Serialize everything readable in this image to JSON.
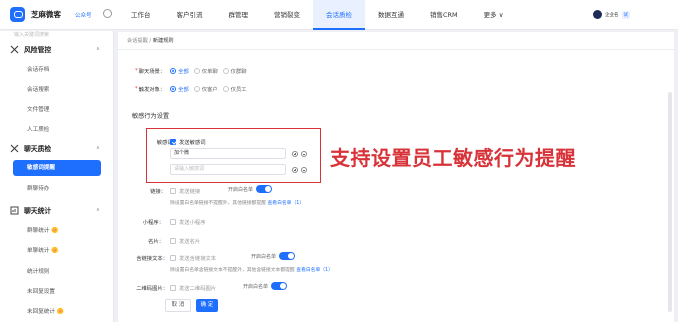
{
  "app": {
    "name": "芝麻微客",
    "badge": "公众号"
  },
  "topnav": {
    "items": [
      "工作台",
      "客户引流",
      "群管理",
      "营销裂变",
      "会话质检",
      "数据互通",
      "销售CRM",
      "更多 ∨"
    ],
    "active_index": 4
  },
  "user": {
    "name": "企业名",
    "chip": "试"
  },
  "sidebar": {
    "search_placeholder": "输入关键词搜索",
    "groups": [
      {
        "label": "风险管控",
        "items": [
          "会话存档",
          "会话搜索",
          "文件管理",
          "人工质检"
        ]
      },
      {
        "label": "聊天质检",
        "items": [
          "敏感词提醒",
          "群聊待办"
        ],
        "active_item": 0
      },
      {
        "label": "聊天统计",
        "items": [
          "群聊统计",
          "单聊统计",
          "统计规则",
          "未回复设置",
          "未回复统计"
        ]
      }
    ],
    "emoji": "🌼"
  },
  "breadcrumb": {
    "parent": "会话提醒",
    "sep": "/",
    "current": "新建规则"
  },
  "form": {
    "chat_scene": {
      "label": "聊天场景：",
      "options": [
        "全部",
        "仅单聊",
        "仅群聊"
      ],
      "selected": 0
    },
    "monitor_target": {
      "label": "触发对象：",
      "options": [
        "全部",
        "仅客户",
        "仅员工"
      ],
      "selected": 0
    },
    "section_title": "敏感行为设置",
    "sensitive_word": {
      "label": "敏感词：",
      "checkbox_label": "发送敏感词",
      "checked": true,
      "input_value": "加个微",
      "input_placeholder": "请输入敏感词"
    },
    "link": {
      "label": "链接：",
      "checkbox_label": "发送链接",
      "whitelist_label": "开启白名单",
      "note": "除设置白名单链接不提醒外，其他链接都提醒",
      "view_link": "查看白名单（1）"
    },
    "mini_program": {
      "label": "小程序：",
      "checkbox_label": "发送小程序"
    },
    "card": {
      "label": "名片：",
      "checkbox_label": "发送名片"
    },
    "link_text": {
      "label": "含链接文本：",
      "checkbox_label": "发送含链接文本",
      "whitelist_label": "开启白名单",
      "note": "除设置白名单含链接文本不提醒外，其他含链接文本都提醒",
      "view_link": "查看白名单（1）"
    },
    "qr_image": {
      "label": "二维码图片：",
      "checkbox_label": "发送二维码图片",
      "whitelist_label": "开启白名单"
    }
  },
  "buttons": {
    "cancel": "取 消",
    "ok": "确 定"
  },
  "callout": "支持设置员工敏感行为提醒",
  "colors": {
    "brand": "#1f6fff",
    "highlight": "#d9333a"
  }
}
